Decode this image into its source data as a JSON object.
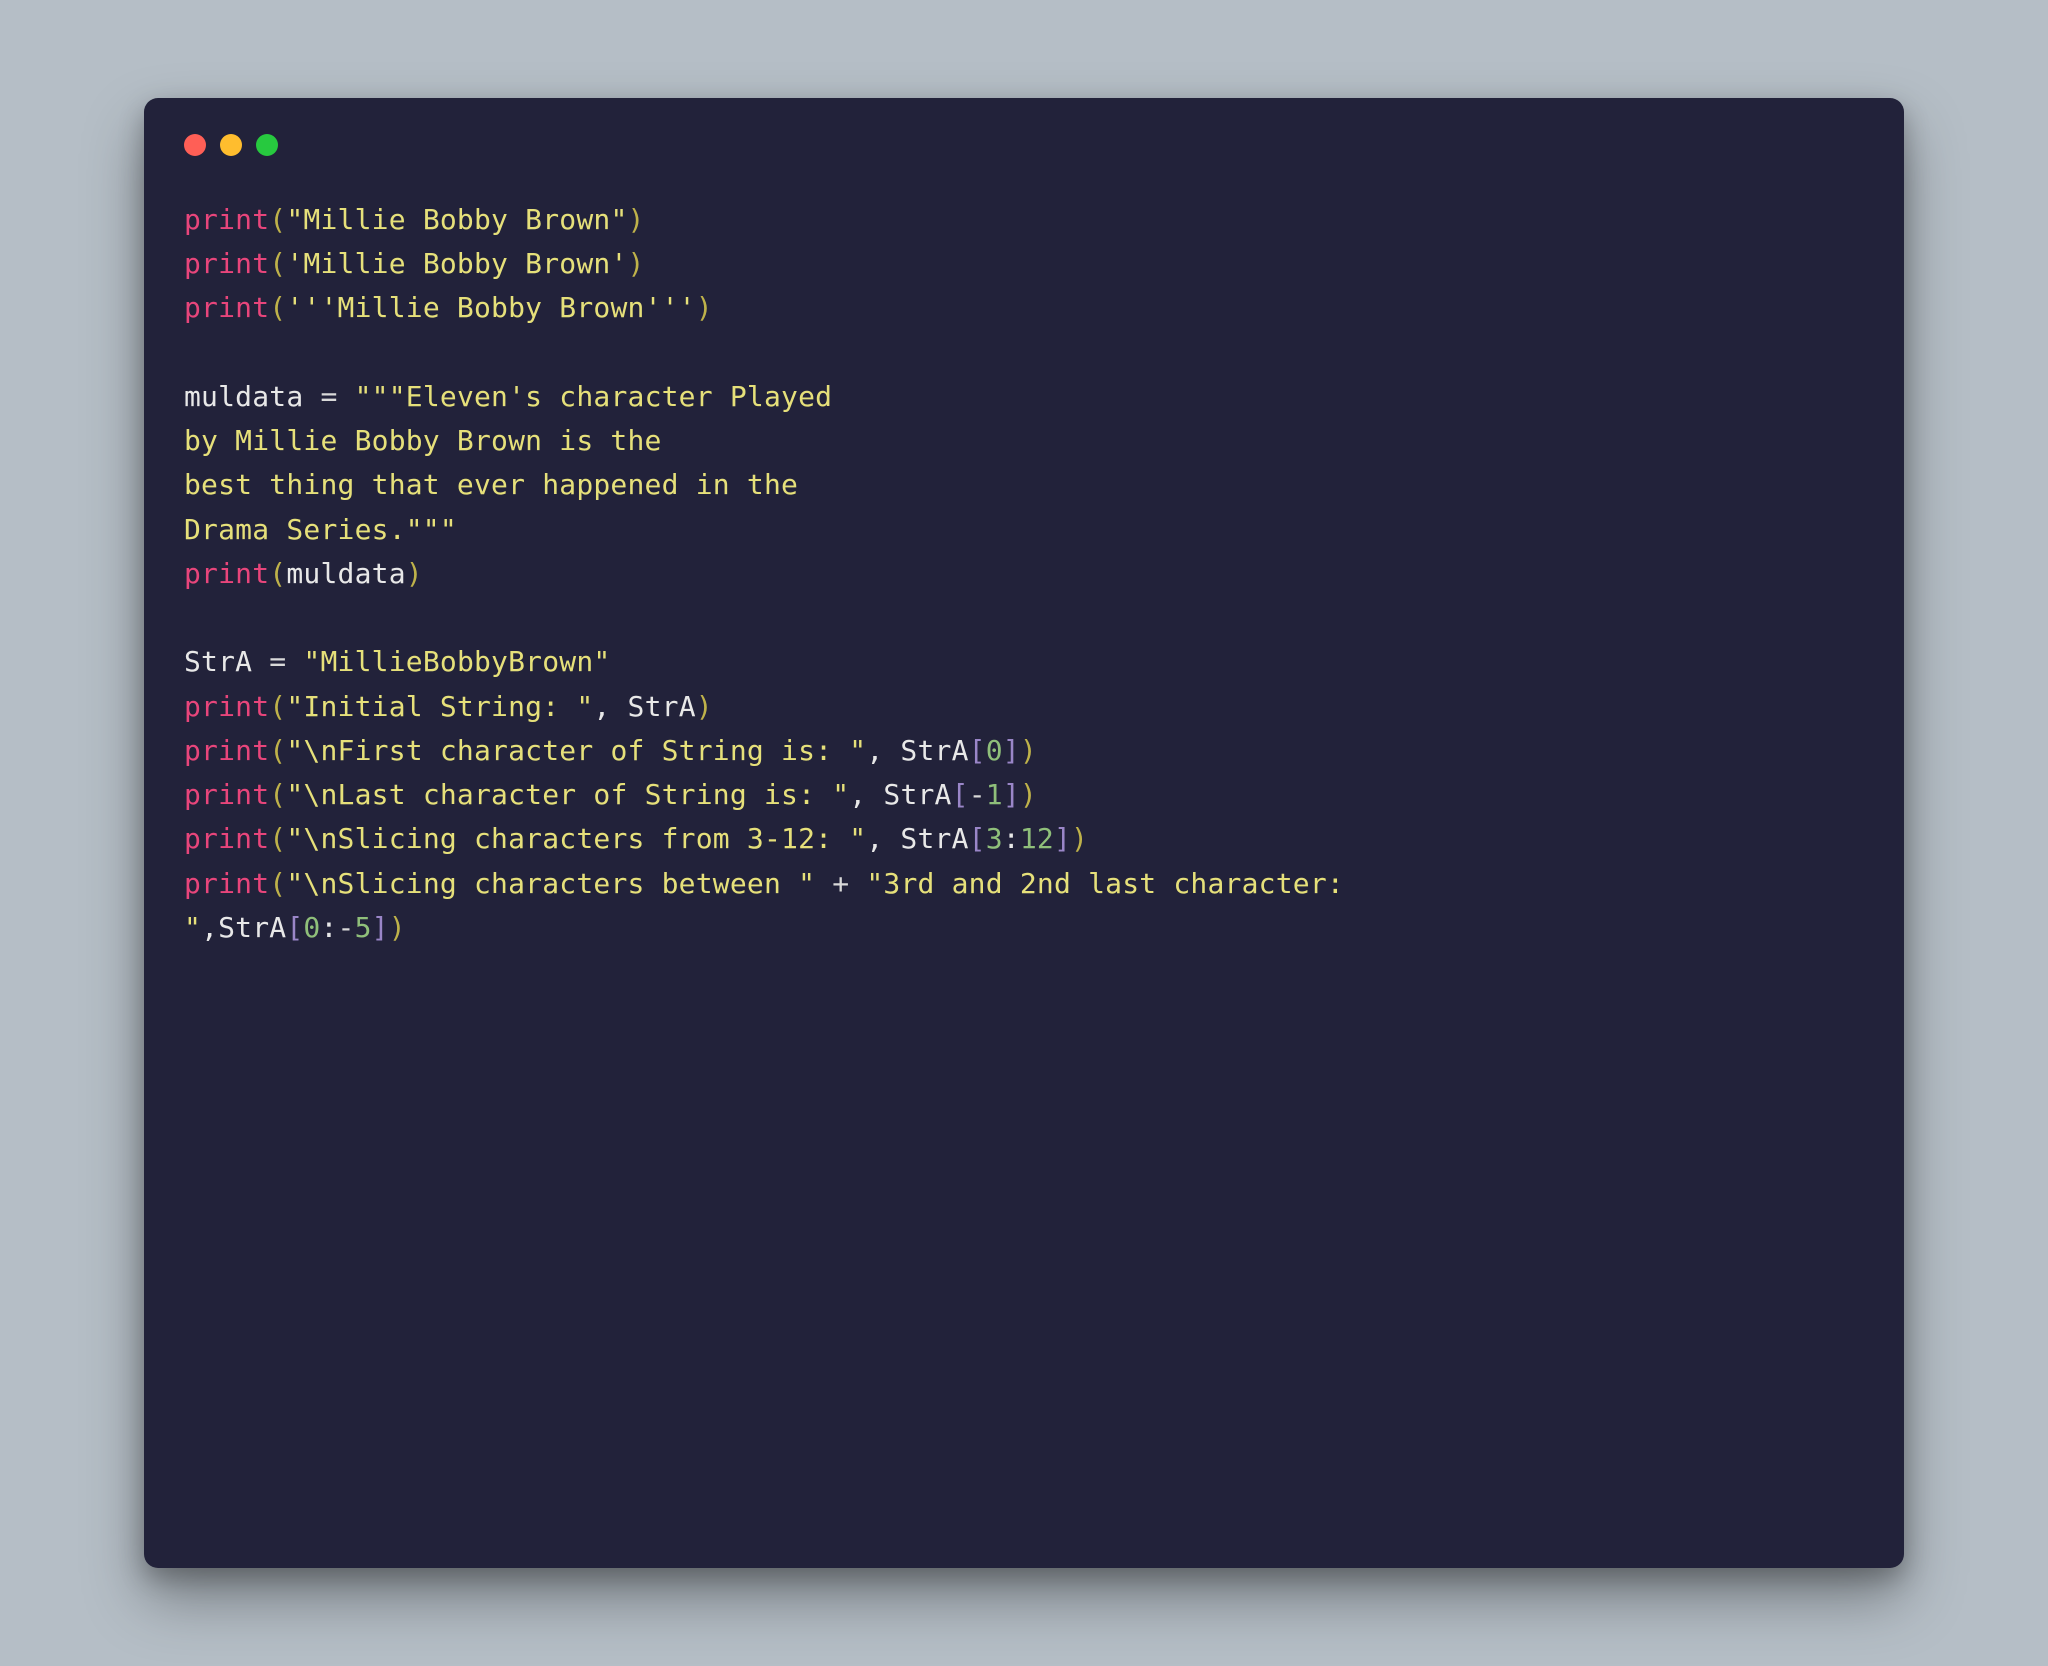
{
  "colors": {
    "bg": "#b5bec6",
    "window": "#22223a",
    "default": "#e8e8e8",
    "fn": "#e8457b",
    "paren": "#bfb24a",
    "string": "#e6e07a",
    "bracket": "#9a86c8",
    "number": "#8fbf7a",
    "dot_red": "#ff5f56",
    "dot_yellow": "#ffbd2e",
    "dot_green": "#27c93f"
  },
  "code": {
    "lines": [
      [
        {
          "c": "fn",
          "t": "print"
        },
        {
          "c": "par",
          "t": "("
        },
        {
          "c": "str",
          "t": "\"Millie Bobby Brown\""
        },
        {
          "c": "par",
          "t": ")"
        }
      ],
      [
        {
          "c": "fn",
          "t": "print"
        },
        {
          "c": "par",
          "t": "("
        },
        {
          "c": "str",
          "t": "'Millie Bobby Brown'"
        },
        {
          "c": "par",
          "t": ")"
        }
      ],
      [
        {
          "c": "fn",
          "t": "print"
        },
        {
          "c": "par",
          "t": "("
        },
        {
          "c": "str",
          "t": "'''Millie Bobby Brown'''"
        },
        {
          "c": "par",
          "t": ")"
        }
      ],
      [],
      [
        {
          "c": "def",
          "t": "muldata "
        },
        {
          "c": "op",
          "t": "="
        },
        {
          "c": "def",
          "t": " "
        },
        {
          "c": "str",
          "t": "\"\"\"Eleven's character Played"
        }
      ],
      [
        {
          "c": "str",
          "t": "by Millie Bobby Brown is the"
        }
      ],
      [
        {
          "c": "str",
          "t": "best thing that ever happened in the"
        }
      ],
      [
        {
          "c": "str",
          "t": "Drama Series.\"\"\""
        }
      ],
      [
        {
          "c": "fn",
          "t": "print"
        },
        {
          "c": "par",
          "t": "("
        },
        {
          "c": "def",
          "t": "muldata"
        },
        {
          "c": "par",
          "t": ")"
        }
      ],
      [],
      [
        {
          "c": "def",
          "t": "StrA "
        },
        {
          "c": "op",
          "t": "="
        },
        {
          "c": "def",
          "t": " "
        },
        {
          "c": "str",
          "t": "\"MillieBobbyBrown\""
        }
      ],
      [
        {
          "c": "fn",
          "t": "print"
        },
        {
          "c": "par",
          "t": "("
        },
        {
          "c": "str",
          "t": "\"Initial String: \""
        },
        {
          "c": "def",
          "t": ", StrA"
        },
        {
          "c": "par",
          "t": ")"
        }
      ],
      [
        {
          "c": "fn",
          "t": "print"
        },
        {
          "c": "par",
          "t": "("
        },
        {
          "c": "str",
          "t": "\"\\nFirst character of String is: \""
        },
        {
          "c": "def",
          "t": ", StrA"
        },
        {
          "c": "br",
          "t": "["
        },
        {
          "c": "num",
          "t": "0"
        },
        {
          "c": "br",
          "t": "]"
        },
        {
          "c": "par",
          "t": ")"
        }
      ],
      [
        {
          "c": "fn",
          "t": "print"
        },
        {
          "c": "par",
          "t": "("
        },
        {
          "c": "str",
          "t": "\"\\nLast character of String is: \""
        },
        {
          "c": "def",
          "t": ", StrA"
        },
        {
          "c": "br",
          "t": "["
        },
        {
          "c": "op",
          "t": "-"
        },
        {
          "c": "num",
          "t": "1"
        },
        {
          "c": "br",
          "t": "]"
        },
        {
          "c": "par",
          "t": ")"
        }
      ],
      [
        {
          "c": "fn",
          "t": "print"
        },
        {
          "c": "par",
          "t": "("
        },
        {
          "c": "str",
          "t": "\"\\nSlicing characters from 3-12: \""
        },
        {
          "c": "def",
          "t": ", StrA"
        },
        {
          "c": "br",
          "t": "["
        },
        {
          "c": "num",
          "t": "3"
        },
        {
          "c": "def",
          "t": ":"
        },
        {
          "c": "num",
          "t": "12"
        },
        {
          "c": "br",
          "t": "]"
        },
        {
          "c": "par",
          "t": ")"
        }
      ],
      [
        {
          "c": "fn",
          "t": "print"
        },
        {
          "c": "par",
          "t": "("
        },
        {
          "c": "str",
          "t": "\"\\nSlicing characters between \""
        },
        {
          "c": "def",
          "t": " "
        },
        {
          "c": "op",
          "t": "+"
        },
        {
          "c": "def",
          "t": " "
        },
        {
          "c": "str",
          "t": "\"3rd and 2nd last character: "
        }
      ],
      [
        {
          "c": "str",
          "t": "\""
        },
        {
          "c": "def",
          "t": ",StrA"
        },
        {
          "c": "br",
          "t": "["
        },
        {
          "c": "num",
          "t": "0"
        },
        {
          "c": "def",
          "t": ":"
        },
        {
          "c": "op",
          "t": "-"
        },
        {
          "c": "num",
          "t": "5"
        },
        {
          "c": "br",
          "t": "]"
        },
        {
          "c": "par",
          "t": ")"
        }
      ]
    ]
  }
}
